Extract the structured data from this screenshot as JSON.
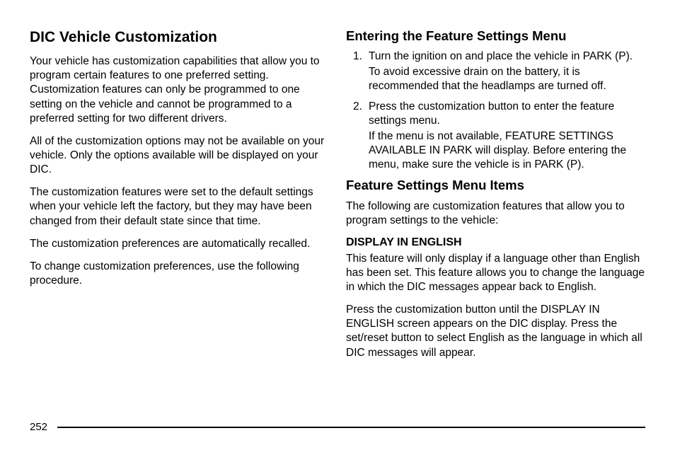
{
  "left": {
    "heading": "DIC Vehicle Customization",
    "p1": "Your vehicle has customization capabilities that allow you to program certain features to one preferred setting. Customization features can only be programmed to one setting on the vehicle and cannot be programmed to a preferred setting for two different drivers.",
    "p2": "All of the customization options may not be available on your vehicle. Only the options available will be displayed on your DIC.",
    "p3": "The customization features were set to the default settings when your vehicle left the factory, but they may have been changed from their default state since that time.",
    "p4": "The customization preferences are automatically recalled.",
    "p5": "To change customization preferences, use the following procedure."
  },
  "right": {
    "heading1": "Entering the Feature Settings Menu",
    "step1_main": "Turn the ignition on and place the vehicle in PARK (P).",
    "step1_note": "To avoid excessive drain on the battery, it is recommended that the headlamps are turned off.",
    "step2_main": "Press the customization button to enter the feature settings menu.",
    "step2_note": "If the menu is not available, FEATURE SETTINGS AVAILABLE IN PARK will display. Before entering the menu, make sure the vehicle is in PARK (P).",
    "heading2": "Feature Settings Menu Items",
    "p_intro": "The following are customization features that allow you to program settings to the vehicle:",
    "sub1": "DISPLAY IN ENGLISH",
    "sub1_p1": "This feature will only display if a language other than English has been set. This feature allows you to change the language in which the DIC messages appear back to English.",
    "sub1_p2": "Press the customization button until the DISPLAY IN ENGLISH screen appears on the DIC display. Press the set/reset button to select English as the language in which all DIC messages will appear."
  },
  "page_number": "252",
  "markers": {
    "one": "1.",
    "two": "2."
  }
}
